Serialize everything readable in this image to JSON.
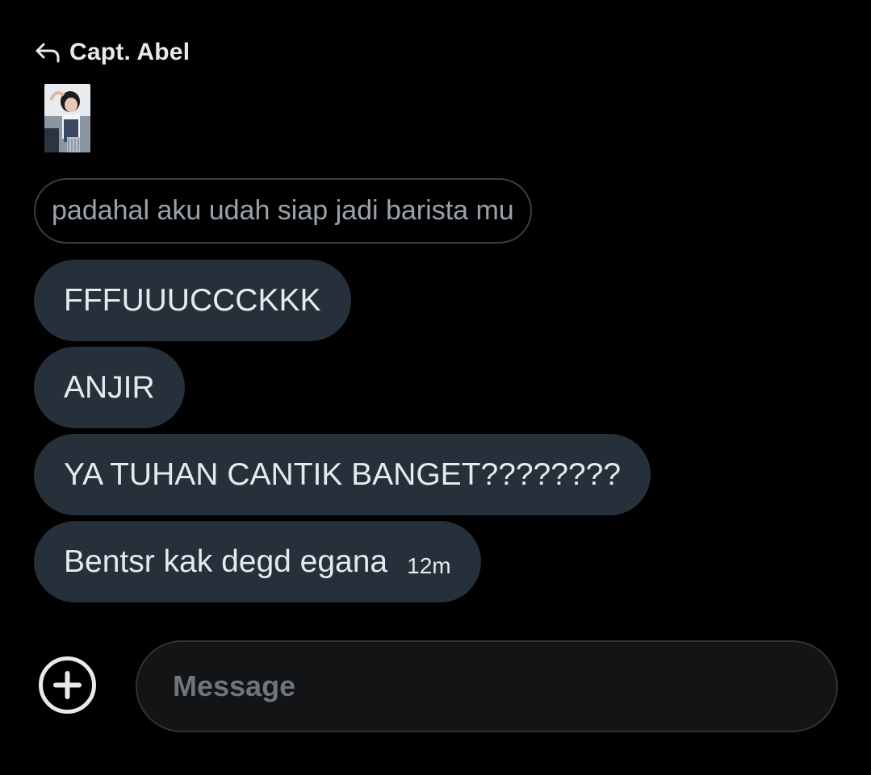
{
  "reply_header": {
    "icon": "reply-arrow-icon",
    "name": "Capt. Abel"
  },
  "quoted_message": {
    "text": "padahal aku udah siap jadi barista mu"
  },
  "messages": [
    {
      "text": "FFFUUUCCCKKK"
    },
    {
      "text": "ANJIR"
    },
    {
      "text": "YA TUHAN CANTIK BANGET????????"
    },
    {
      "text": "Bentsr kak degd egana",
      "timestamp": "12m"
    }
  ],
  "composer": {
    "add_icon": "plus-circle-icon",
    "placeholder": "Message"
  },
  "colors": {
    "background": "#000000",
    "bubble": "#25303a",
    "text": "#e7e9ea",
    "muted_text": "#9aa3ab",
    "placeholder": "#71767b"
  }
}
